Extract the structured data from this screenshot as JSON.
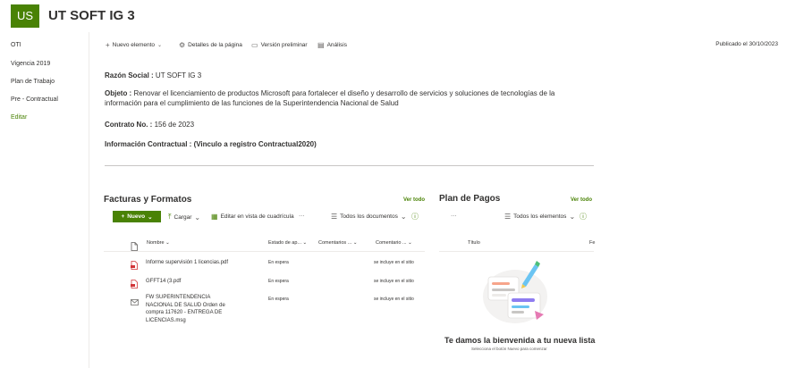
{
  "header": {
    "logo": "US",
    "title": "UT SOFT IG 3"
  },
  "nav": {
    "items": [
      {
        "label": "OTI"
      },
      {
        "label": "Vigencia 2019"
      },
      {
        "label": "Plan de Trabajo"
      },
      {
        "label": "Pre - Contractual"
      }
    ],
    "edit": "Editar"
  },
  "commandbar": {
    "new": "Nuevo elemento",
    "details": "Detalles de la página",
    "preview": "Versión preliminar",
    "analytics": "Análisis",
    "published": "Publicado el 30/10/2023"
  },
  "content": {
    "razon_label": "Razón Social :",
    "razon_value": "UT SOFT IG 3",
    "objeto_label": "Objeto :",
    "objeto_value": "Renovar el licenciamiento de productos Microsoft para fortalecer el diseño y desarrollo de servicios y soluciones de tecnologías de la información para el cumplimiento de las funciones de la Superintendencia Nacional de Salud",
    "contrato_label": "Contrato No. :",
    "contrato_value": "156 de 2023",
    "info_label": "Información Contractual : (Vinculo a registro Contractual2020)"
  },
  "facturas": {
    "title": "Facturas y Formatos",
    "see_all": "Ver todo",
    "new_btn": "Nuevo",
    "upload": "Cargar",
    "grid_edit": "Editar en vista de cuadrícula",
    "more": "···",
    "view": "Todos los documentos",
    "columns": [
      "Nombre",
      "Estado de ap...",
      "Comentarios ...",
      "Comentario ..."
    ],
    "rows": [
      {
        "name": "Informe supervisión 1 licencias.pdf",
        "estado": "En espera",
        "comentario": "se incluye en el sitio"
      },
      {
        "name": "GFFT14 (3.pdf",
        "estado": "En espera",
        "comentario": "se incluye en el sitio"
      },
      {
        "name": "FW SUPERINTENDENCIA NACIONAL DE SALUD Orden de compra 117620 - ENTREGA DE LICENCIAS.msg",
        "estado": "En espera",
        "comentario": "se incluye en el sitio"
      }
    ]
  },
  "pagos": {
    "title": "Plan de Pagos",
    "see_all": "Ver todo",
    "more": "···",
    "view": "Todos los elementos",
    "col_titulo": "Título",
    "col_fe": "Fe",
    "welcome": "Te damos la bienvenida a tu nueva lista",
    "welcome_sub": "Selecciona el botón Nuevo para comenzar"
  },
  "colors": {
    "brand": "#498205",
    "pdf": "#d13438",
    "text": "#323130"
  }
}
